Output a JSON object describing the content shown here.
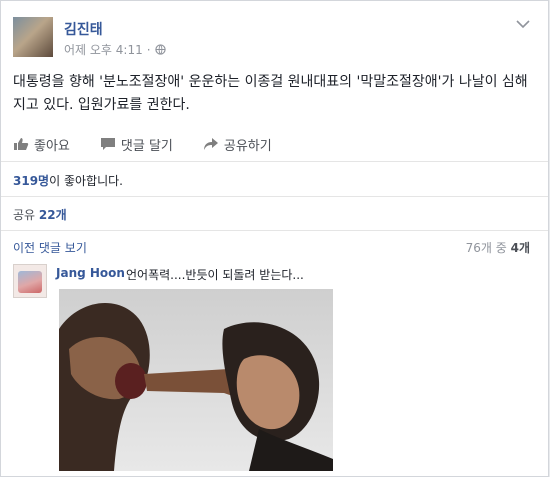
{
  "post": {
    "author": "김진태",
    "time": "어제 오후 4:11",
    "separator": "·",
    "text": "대통령을 향해 '분노조절장애' 운운하는 이종걸 원내대표의 '막말조절장애'가 나날이 심해지고 있다. 입원가료를 권한다."
  },
  "actions": {
    "like": "좋아요",
    "comment": "댓글 달기",
    "share": "공유하기"
  },
  "stats": {
    "likes_count": "319명",
    "likes_suffix": "이 좋아합니다.",
    "shares_prefix": "공유 ",
    "shares_count": "22개"
  },
  "comments": {
    "view_previous": "이전 댓글 보기",
    "shown": "76개",
    "of": " 중 ",
    "total": "4개",
    "items": [
      {
        "author": "Jang Hoon",
        "text": "언어폭력....반듯이 되돌려 받는다..."
      }
    ]
  },
  "icons": {
    "globe": "globe-icon",
    "chevron": "chevron-down-icon",
    "like": "thumbs-up-icon",
    "comment": "comment-icon",
    "share": "share-icon"
  },
  "colors": {
    "link": "#365899",
    "muted": "#90949c"
  }
}
